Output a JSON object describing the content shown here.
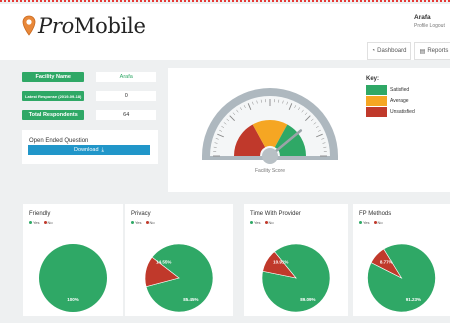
{
  "brand": {
    "prefix": "Pro",
    "suffix": "Mobile"
  },
  "user": {
    "name": "Arafa",
    "links": "Profile  Logout"
  },
  "nav": [
    {
      "label": "Dashboard",
      "icon": "chart-icon"
    },
    {
      "label": "Reports",
      "icon": "document-icon"
    }
  ],
  "info": {
    "facility_label": "Facility Name",
    "facility_value": "Arafa",
    "latest_label": "Latest Response (2019-09-18)",
    "latest_value": "0",
    "total_label": "Total Respondents",
    "total_value": "64"
  },
  "open_ended": {
    "title": "Open Ended Question",
    "button": "Download"
  },
  "gauge": {
    "caption": "Facility Score",
    "needle_fraction": 0.78
  },
  "key": {
    "title": "Key:",
    "items": [
      {
        "label": "Satisfied",
        "color": "#2fa866"
      },
      {
        "label": "Average",
        "color": "#f5a623"
      },
      {
        "label": "Unsatisfied",
        "color": "#c0392b"
      }
    ]
  },
  "colors": {
    "yes": "#2fa866",
    "no": "#c0392b",
    "average": "#f5a623"
  },
  "chart_data": [
    {
      "type": "pie",
      "title": "Friendly",
      "legend": [
        "Yes",
        "No"
      ],
      "values": [
        100,
        0
      ],
      "labels": [
        "100%",
        ""
      ]
    },
    {
      "type": "pie",
      "title": "Privacy",
      "legend": [
        "Yes",
        "No"
      ],
      "values": [
        85.45,
        14.55
      ],
      "labels": [
        "85.45%",
        "14.55%"
      ]
    },
    {
      "type": "pie",
      "title": "Time With Provider",
      "legend": [
        "Yes",
        "No"
      ],
      "values": [
        89.09,
        10.91
      ],
      "labels": [
        "89.09%",
        "10.91%"
      ]
    },
    {
      "type": "pie",
      "title": "FP Methods",
      "legend": [
        "Yes",
        "No"
      ],
      "values": [
        91.23,
        8.77
      ],
      "labels": [
        "91.23%",
        "8.77%"
      ]
    }
  ]
}
